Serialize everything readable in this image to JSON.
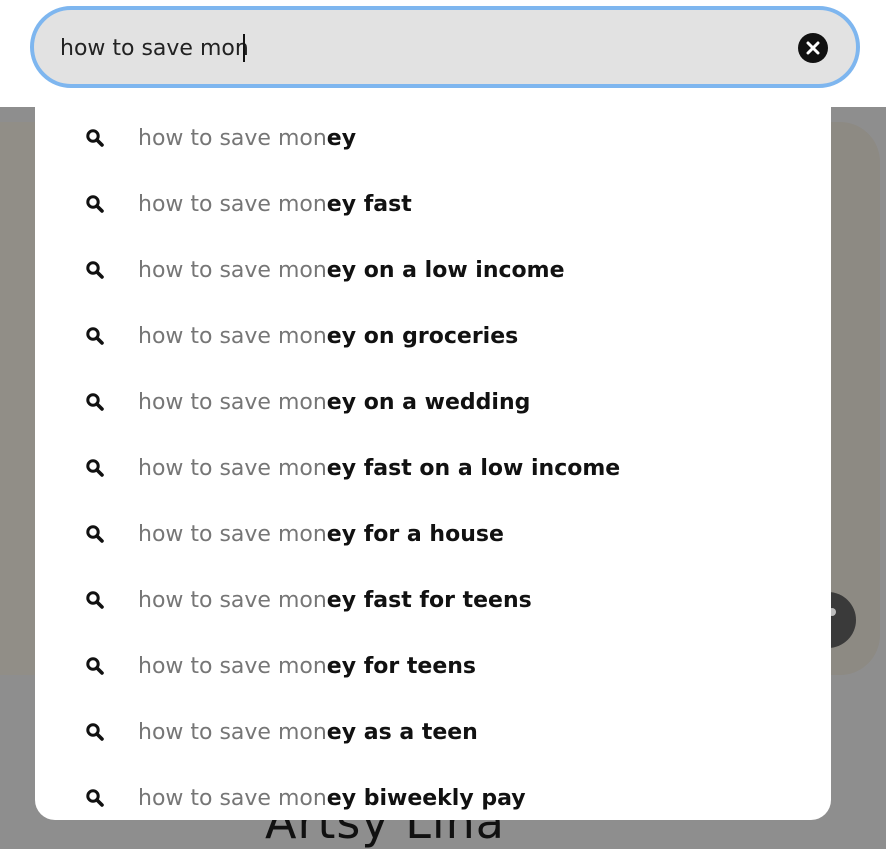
{
  "search": {
    "query": "how to save mon",
    "clear_icon": "close-icon"
  },
  "suggestions": [
    {
      "typed": "how to save mon",
      "completion": "ey"
    },
    {
      "typed": "how to save mon",
      "completion": "ey fast"
    },
    {
      "typed": "how to save mon",
      "completion": "ey on a low income"
    },
    {
      "typed": "how to save mon",
      "completion": "ey on groceries"
    },
    {
      "typed": "how to save mon",
      "completion": "ey on a wedding"
    },
    {
      "typed": "how to save mon",
      "completion": "ey fast on a low income"
    },
    {
      "typed": "how to save mon",
      "completion": "ey for a house"
    },
    {
      "typed": "how to save mon",
      "completion": "ey fast for teens"
    },
    {
      "typed": "how to save mon",
      "completion": "ey for teens"
    },
    {
      "typed": "how to save mon",
      "completion": "ey as a teen"
    },
    {
      "typed": "how to save mon",
      "completion": "ey biweekly pay"
    }
  ],
  "suggestion_icon": "search-icon",
  "background": {
    "title": "Artsy Lina"
  },
  "colors": {
    "focus_ring": "#7eb6ef",
    "search_bg": "#e2e2e2",
    "typed_text": "#767676",
    "completion_text": "#111111",
    "overlay": "#8e8e8e"
  }
}
